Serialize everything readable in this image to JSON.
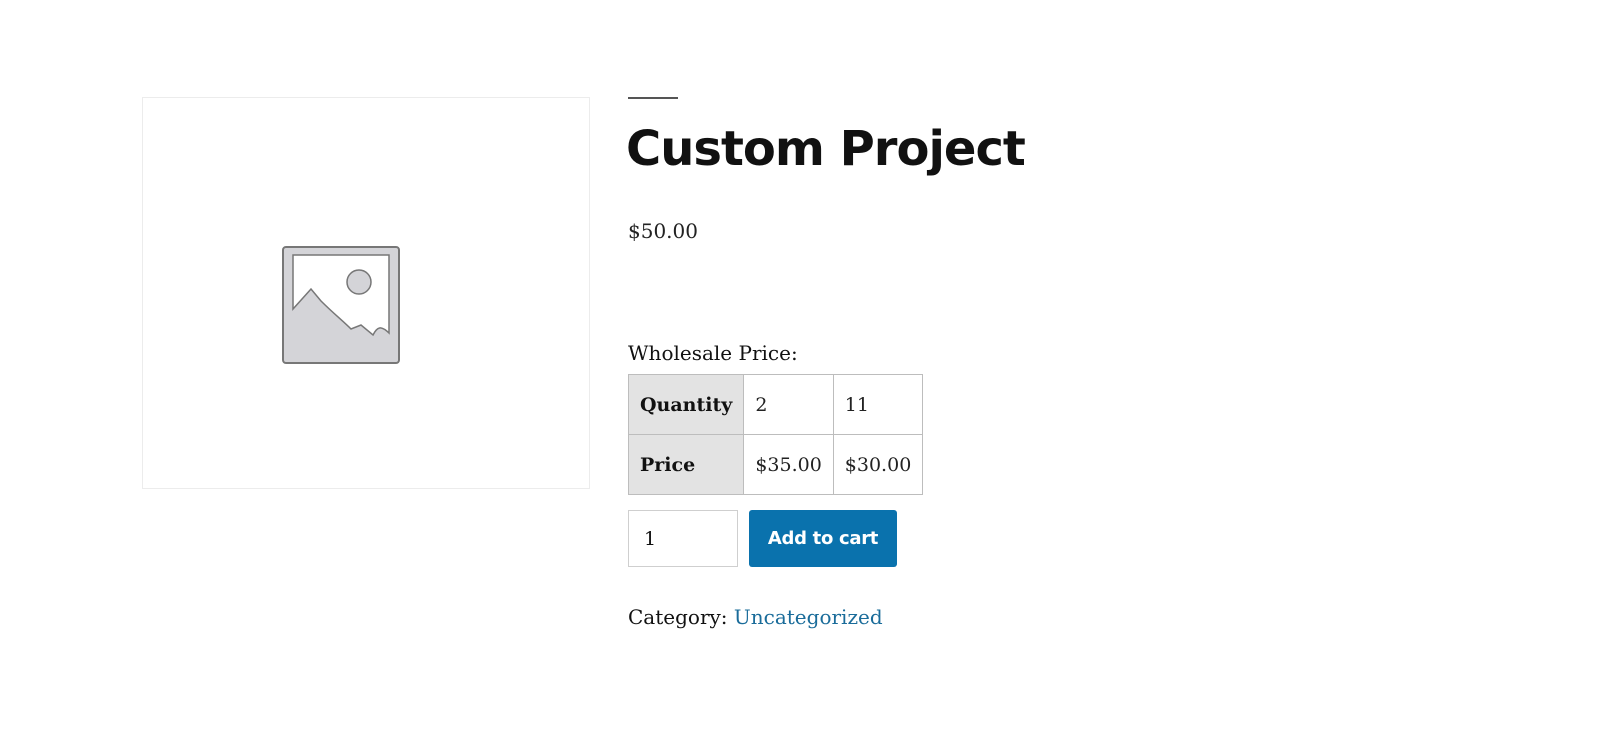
{
  "product": {
    "title": "Custom Project",
    "price": "$50.00",
    "image_icon": "image-placeholder-icon"
  },
  "wholesale": {
    "label": "Wholesale Price:",
    "quantity_header": "Quantity",
    "price_header": "Price",
    "quantities": [
      "2",
      "11"
    ],
    "prices": [
      "$35.00",
      "$30.00"
    ]
  },
  "cart": {
    "quantity_value": "1",
    "button_label": "Add to cart"
  },
  "meta": {
    "category_label": "Category:",
    "category_value": "Uncategorized"
  },
  "colors": {
    "button": "#0a72ad",
    "link": "#1a6c9a",
    "table_header_bg": "#e3e3e3"
  }
}
